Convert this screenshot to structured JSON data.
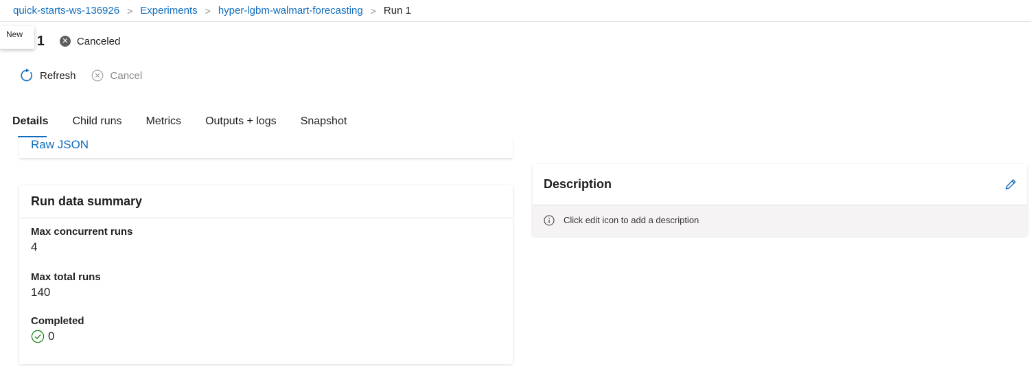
{
  "breadcrumb": {
    "items": [
      "quick-starts-ws-136926",
      "Experiments",
      "hyper-lgbm-walmart-forecasting"
    ],
    "separator": ">",
    "current": "Run 1"
  },
  "tooltip": {
    "text": "New"
  },
  "header": {
    "title": "n 1",
    "status": "Canceled",
    "status_icon": "x-circle-icon"
  },
  "toolbar": {
    "refresh_label": "Refresh",
    "cancel_label": "Cancel"
  },
  "tabs": [
    {
      "label": "Details",
      "active": true
    },
    {
      "label": "Child runs",
      "active": false
    },
    {
      "label": "Metrics",
      "active": false
    },
    {
      "label": "Outputs + logs",
      "active": false
    },
    {
      "label": "Snapshot",
      "active": false
    }
  ],
  "properties_card": {
    "raw_json_link": "Raw JSON"
  },
  "run_data_summary": {
    "title": "Run data summary",
    "fields": [
      {
        "label": "Max concurrent runs",
        "value": "4"
      },
      {
        "label": "Max total runs",
        "value": "140"
      },
      {
        "label": "Completed",
        "value": "0"
      }
    ]
  },
  "description": {
    "title": "Description",
    "placeholder": "Click edit icon to add a description"
  },
  "colors": {
    "accent": "#0f6cbd",
    "status_canceled": "#605e5c",
    "success": "#107c10",
    "desc_bg": "#f6f3f5"
  }
}
